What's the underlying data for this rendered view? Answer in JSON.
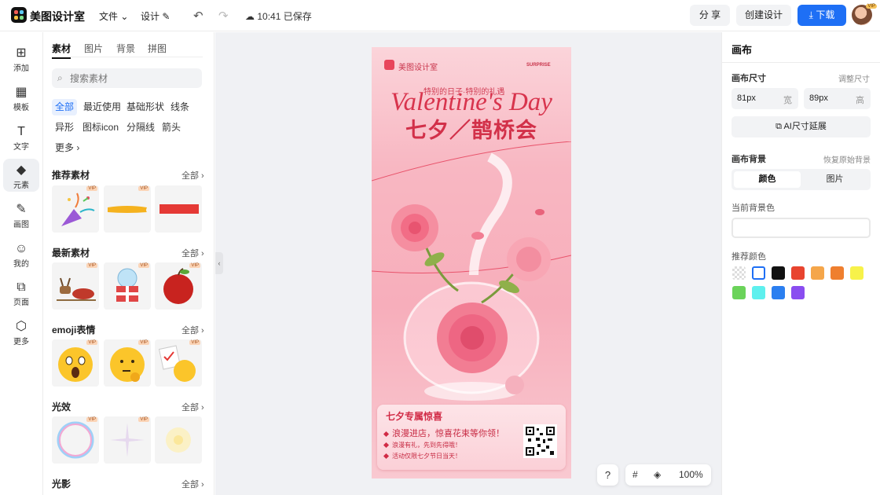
{
  "app": {
    "brand": "美图设计室"
  },
  "topbar": {
    "file_menu": "文件",
    "design_menu": "设计",
    "save_status": "10:41 已保存",
    "share_label": "分 享",
    "create_label": "创建设计",
    "download_label": "下载",
    "avatar_badge": "VIP"
  },
  "sidenav": {
    "items": [
      {
        "label": "添加",
        "icon": "plus-square-icon"
      },
      {
        "label": "模板",
        "icon": "template-icon"
      },
      {
        "label": "文字",
        "icon": "text-icon"
      },
      {
        "label": "元素",
        "icon": "shapes-icon"
      },
      {
        "label": "画图",
        "icon": "draw-icon"
      },
      {
        "label": "我的",
        "icon": "user-icon"
      },
      {
        "label": "页面",
        "icon": "page-add-icon"
      },
      {
        "label": "更多",
        "icon": "cube-icon"
      }
    ],
    "active": "元素"
  },
  "panel": {
    "tabs": [
      "素材",
      "图片",
      "背景",
      "拼图"
    ],
    "active_tab": "素材",
    "search_placeholder": "搜索素材",
    "chips": [
      "全部",
      "最近使用",
      "基础形状",
      "线条",
      "异形",
      "图标icon",
      "分隔线",
      "箭头",
      "更多"
    ],
    "active_chip": "全部",
    "sections": [
      {
        "title": "推荐素材",
        "all": "全部"
      },
      {
        "title": "最新素材",
        "all": "全部"
      },
      {
        "title": "emoji表情",
        "all": "全部"
      },
      {
        "title": "光效",
        "all": "全部"
      },
      {
        "title": "光影",
        "all": "全部"
      }
    ],
    "vip_badge": "VIP"
  },
  "poster": {
    "brand": "美图设计室",
    "surprise": "SURPRISE",
    "tagline": "特别的日子·特别的礼遇",
    "title_en": "Valentine's Day",
    "title_cn": "七夕／鹊桥会",
    "card_title": "七夕专属惊喜",
    "card_lines": [
      "浪漫进店，惊喜花束等你领！",
      "浪漫有礼，先到先得哦！",
      "活动仅限七夕节日当天！"
    ]
  },
  "canvas": {
    "help": "?",
    "zoom": "100%"
  },
  "rightpanel": {
    "title": "画布",
    "size_label": "画布尺寸",
    "size_action": "调整尺寸",
    "width_value": "81px",
    "width_unit": "宽",
    "height_value": "89px",
    "height_unit": "高",
    "ai_extend": "AI尺寸延展",
    "bg_label": "画布背景",
    "bg_restore": "恢复原始背景",
    "bg_tab_color": "颜色",
    "bg_tab_image": "图片",
    "current_color_label": "当前背景色",
    "recommended_label": "推荐颜色",
    "swatches": [
      "transparent",
      "#ffffff",
      "#111111",
      "#e8442f",
      "#f5a64a",
      "#ef7f2f",
      "#f7f24a",
      "#6bd35a",
      "#5ef0ee",
      "#2b7ff0",
      "#8a4df0"
    ]
  }
}
